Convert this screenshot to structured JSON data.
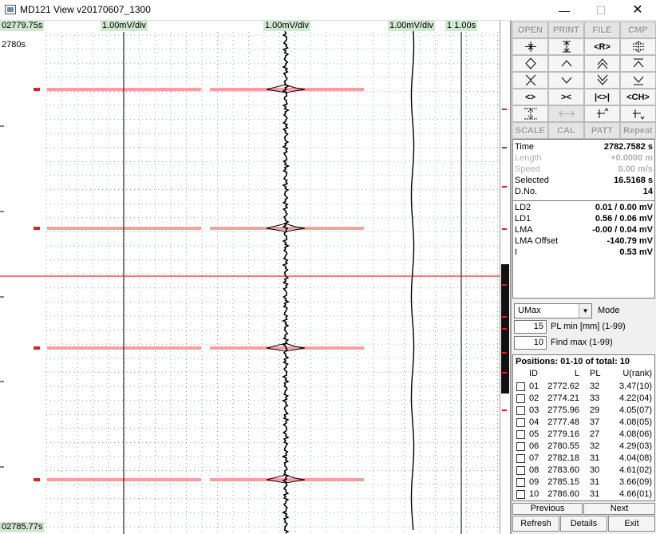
{
  "window": {
    "title": "MD121 View v20170607_1300",
    "minimize": "—",
    "maximize": "☐",
    "close": "✕"
  },
  "plot": {
    "time_top": "02779.75s",
    "time_bottom": "02785.77s",
    "scale_marker": "2780s",
    "div_labels": [
      "1.00mV/div",
      "1.00mV/div",
      "1.00mV/div",
      "1 1.00s"
    ]
  },
  "toolbar": {
    "row1": [
      "OPEN",
      "PRINT",
      "FILE",
      "CMP"
    ],
    "row4": [
      "<>",
      "><",
      "|<>|",
      "<CH>"
    ],
    "row6": [
      "SCALE",
      "CAL",
      "PATT",
      "Repeat"
    ],
    "row_r": "<R>"
  },
  "info": {
    "time_label": "Time",
    "time_value": "2782.7582 s",
    "length_label": "Length",
    "length_value": "+0.0000 m",
    "speed_label": "Speed",
    "speed_value": "0.00 m/s",
    "selected_label": "Selected",
    "selected_value": "16.5168 s",
    "dno_label": "D.No.",
    "dno_value": "14",
    "ld2_label": "LD2",
    "ld2_value": "0.01 / 0.00 mV",
    "ld1_label": "LD1",
    "ld1_value": "0.56 / 0.06 mV",
    "lma_label": "LMA",
    "lma_value": "-0.00 / 0.04 mV",
    "lmaoff_label": "LMA Offset",
    "lmaoff_value": "-140.79 mV",
    "i_label": "I",
    "i_value": "0.53 mV"
  },
  "mode": {
    "selected": "UMax",
    "label": "Mode",
    "pl_min_value": "15",
    "pl_min_label": "PL min [mm] (1-99)",
    "find_max_value": "10",
    "find_max_label": "Find max (1-99)"
  },
  "positions": {
    "title": "Positions: 01-10 of total: 10",
    "headers": {
      "id": "ID",
      "l": "L",
      "pl": "PL",
      "u": "U(rank)"
    },
    "rows": [
      {
        "id": "01",
        "l": "2772.62",
        "pl": "32",
        "u": "3.47(10)"
      },
      {
        "id": "02",
        "l": "2774.21",
        "pl": "33",
        "u": "4.22(04)"
      },
      {
        "id": "03",
        "l": "2775.96",
        "pl": "29",
        "u": "4.05(07)"
      },
      {
        "id": "04",
        "l": "2777.48",
        "pl": "37",
        "u": "4.08(05)"
      },
      {
        "id": "05",
        "l": "2779.16",
        "pl": "27",
        "u": "4.08(06)"
      },
      {
        "id": "06",
        "l": "2780.55",
        "pl": "32",
        "u": "4.29(03)"
      },
      {
        "id": "07",
        "l": "2782.18",
        "pl": "31",
        "u": "4.04(08)"
      },
      {
        "id": "08",
        "l": "2783.60",
        "pl": "30",
        "u": "4.61(02)"
      },
      {
        "id": "09",
        "l": "2785.15",
        "pl": "31",
        "u": "3.66(09)"
      },
      {
        "id": "10",
        "l": "2786.60",
        "pl": "31",
        "u": "4.66(01)"
      }
    ]
  },
  "buttons": {
    "previous": "Previous",
    "next": "Next",
    "refresh": "Refresh",
    "details": "Details",
    "exit": "Exit"
  },
  "colors": {
    "highlight": "#f4a0a0",
    "marker": "#e02020",
    "label_bg": "#cfe8cf",
    "cursor_line": "#c00000"
  }
}
